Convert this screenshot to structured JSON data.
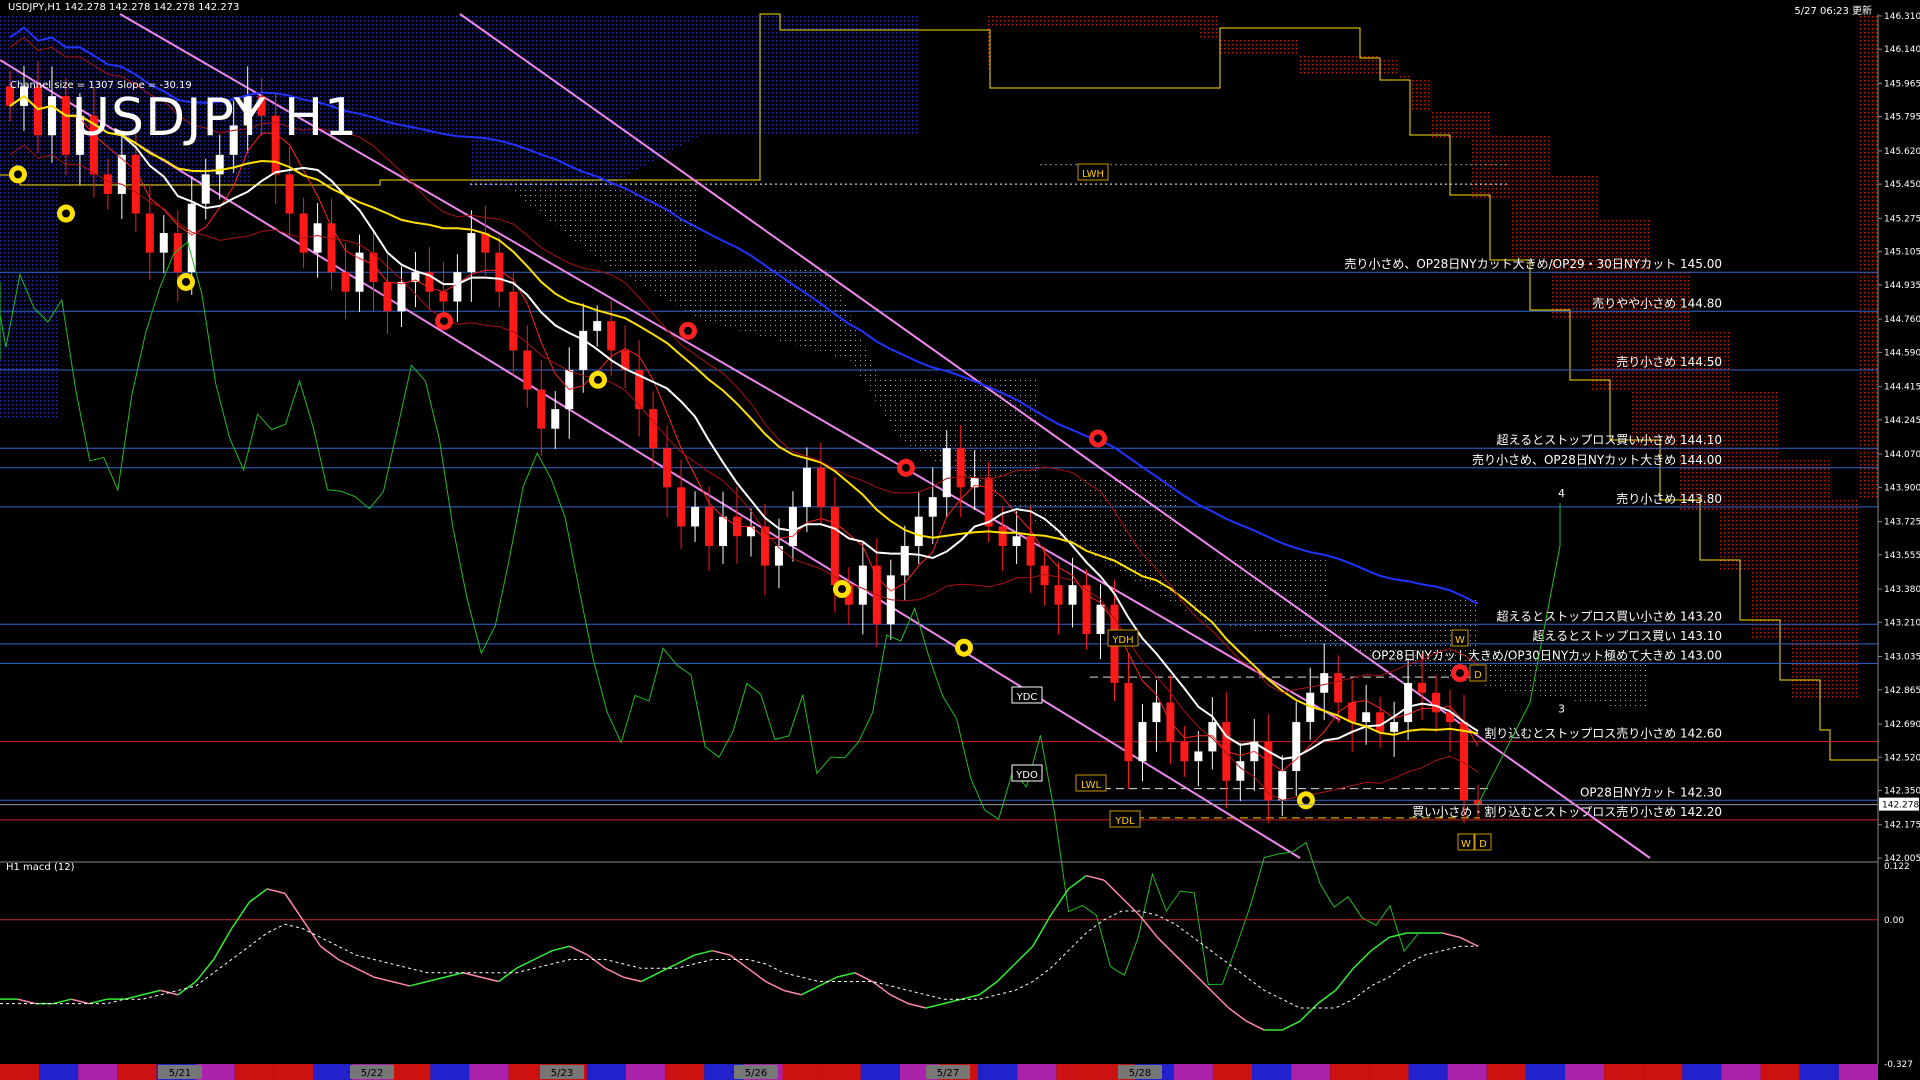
{
  "header": {
    "ohlc_text": "USDJPY,H1  142.278 142.278 142.278 142.273",
    "timestamp": "5/27 06:23 更新"
  },
  "symbol_label": "USDJPY H1",
  "channel_info": "Channel size = 1307 Slope = -30.19",
  "macd_label": "H1  macd (12)",
  "colors": {
    "background": "#000000",
    "bull_candle": "#ffffff",
    "bear_candle": "#ff1a1a",
    "ma_white": "#ffffff",
    "ma_yellow": "#ffe000",
    "ma_blue": "#2233ff",
    "channel_violet": "#ee88ee",
    "chikou_green": "#22bb22",
    "kumo_blue": "#2233cc",
    "kumo_red": "#cc2200",
    "level_line": "#3366cc",
    "macd_green": "#33ee33",
    "macd_pink": "#ff88aa"
  },
  "chart_data": [
    {
      "type": "line",
      "panel": "main",
      "y_axis_range": [
        142.005,
        146.32
      ],
      "y_ticks": [
        146.31,
        146.14,
        145.965,
        145.795,
        145.62,
        145.45,
        145.275,
        145.105,
        144.935,
        144.76,
        144.59,
        144.415,
        144.245,
        144.07,
        143.9,
        143.725,
        143.555,
        143.38,
        143.21,
        143.035,
        142.865,
        142.69,
        142.52,
        142.35,
        142.175,
        142.005
      ],
      "x_labels": [
        "5/21",
        "5/22",
        "5/23",
        "5/26",
        "5/27",
        "5/28"
      ],
      "current_price": 142.278,
      "levels": [
        {
          "price": 145.0,
          "label": "売り小さめ、OP28日NYカット大きめ/OP29・30日NYカット 145.00"
        },
        {
          "price": 144.8,
          "label": "売りやや小さめ 144.80"
        },
        {
          "price": 144.5,
          "label": "売り小さめ 144.50"
        },
        {
          "price": 144.1,
          "label": "超えるとストップロス買い小さめ 144.10"
        },
        {
          "price": 144.0,
          "label": "売り小さめ、OP28日NYカット大きめ 144.00"
        },
        {
          "price": 143.8,
          "label": "売り小さめ 143.80"
        },
        {
          "price": 143.2,
          "label": "超えるとストップロス買い小さめ 143.20"
        },
        {
          "price": 143.1,
          "label": "超えるとストップロス買い 143.10"
        },
        {
          "price": 143.0,
          "label": "OP28日NYカット大きめ/OP30日NYカット極めて大きめ 143.00"
        },
        {
          "price": 142.6,
          "label": "割り込むとストップロス売り小さめ 142.60"
        },
        {
          "price": 142.3,
          "label": "OP28日NYカット 142.30"
        },
        {
          "price": 142.2,
          "label": "買い小さめ・割り込むとストップロス売り小さめ 142.20"
        }
      ],
      "markers": [
        "LWH",
        "YDH",
        "YDC",
        "YDO",
        "LWL",
        "YDL",
        "W",
        "D"
      ],
      "wave_numbers": [
        "4",
        "3"
      ],
      "candles_close": [
        145.85,
        145.95,
        145.7,
        145.9,
        145.6,
        145.8,
        145.5,
        145.4,
        145.6,
        145.3,
        145.1,
        145.2,
        145.0,
        145.35,
        145.5,
        145.6,
        145.75,
        145.9,
        145.8,
        145.5,
        145.3,
        145.1,
        145.25,
        145.0,
        144.9,
        145.1,
        144.95,
        144.8,
        144.95,
        145.0,
        144.9,
        144.85,
        145.0,
        145.2,
        145.1,
        144.9,
        144.6,
        144.4,
        144.2,
        144.3,
        144.5,
        144.7,
        144.75,
        144.6,
        144.5,
        144.3,
        144.1,
        143.9,
        143.7,
        143.8,
        143.6,
        143.75,
        143.65,
        143.7,
        143.5,
        143.6,
        143.8,
        144.0,
        143.8,
        143.4,
        143.3,
        143.5,
        143.2,
        143.45,
        143.6,
        143.75,
        143.85,
        144.1,
        143.9,
        143.95,
        143.7,
        143.6,
        143.65,
        143.5,
        143.4,
        143.3,
        143.4,
        143.15,
        143.3,
        142.9,
        142.5,
        142.7,
        142.8,
        142.6,
        142.5,
        142.55,
        142.7,
        142.4,
        142.5,
        142.6,
        142.3,
        142.45,
        142.7,
        142.85,
        142.95,
        142.8,
        142.7,
        142.75,
        142.65,
        142.7,
        142.9,
        142.85,
        142.75,
        142.7,
        142.3,
        142.28
      ]
    },
    {
      "type": "line",
      "panel": "macd",
      "y_axis_range": [
        -0.327,
        0.122
      ],
      "y_ticks": [
        0.122,
        0.0,
        -0.327
      ],
      "series": [
        {
          "name": "macd",
          "values": [
            -0.18,
            -0.18,
            -0.19,
            -0.19,
            -0.18,
            -0.19,
            -0.18,
            -0.18,
            -0.17,
            -0.16,
            -0.17,
            -0.14,
            -0.09,
            -0.02,
            0.04,
            0.07,
            0.06,
            0.0,
            -0.06,
            -0.09,
            -0.11,
            -0.13,
            -0.14,
            -0.15,
            -0.14,
            -0.13,
            -0.12,
            -0.13,
            -0.14,
            -0.11,
            -0.09,
            -0.07,
            -0.06,
            -0.08,
            -0.11,
            -0.13,
            -0.14,
            -0.12,
            -0.1,
            -0.08,
            -0.07,
            -0.08,
            -0.11,
            -0.14,
            -0.16,
            -0.17,
            -0.15,
            -0.13,
            -0.12,
            -0.14,
            -0.17,
            -0.19,
            -0.2,
            -0.19,
            -0.18,
            -0.17,
            -0.14,
            -0.1,
            -0.06,
            0.01,
            0.07,
            0.1,
            0.09,
            0.05,
            0.01,
            -0.04,
            -0.08,
            -0.12,
            -0.16,
            -0.2,
            -0.23,
            -0.25,
            -0.25,
            -0.23,
            -0.19,
            -0.16,
            -0.11,
            -0.07,
            -0.04,
            -0.03,
            -0.03,
            -0.03,
            -0.04,
            -0.06
          ]
        },
        {
          "name": "signal",
          "values": [
            -0.19,
            -0.19,
            -0.19,
            -0.19,
            -0.19,
            -0.19,
            -0.19,
            -0.18,
            -0.18,
            -0.17,
            -0.16,
            -0.15,
            -0.12,
            -0.09,
            -0.06,
            -0.03,
            -0.01,
            -0.02,
            -0.04,
            -0.06,
            -0.08,
            -0.09,
            -0.1,
            -0.11,
            -0.12,
            -0.12,
            -0.12,
            -0.12,
            -0.12,
            -0.12,
            -0.11,
            -0.1,
            -0.09,
            -0.09,
            -0.09,
            -0.1,
            -0.11,
            -0.11,
            -0.11,
            -0.1,
            -0.09,
            -0.09,
            -0.09,
            -0.1,
            -0.12,
            -0.13,
            -0.14,
            -0.14,
            -0.14,
            -0.14,
            -0.15,
            -0.16,
            -0.17,
            -0.18,
            -0.18,
            -0.18,
            -0.17,
            -0.16,
            -0.14,
            -0.11,
            -0.07,
            -0.03,
            0.0,
            0.02,
            0.02,
            0.01,
            -0.01,
            -0.04,
            -0.07,
            -0.1,
            -0.13,
            -0.16,
            -0.18,
            -0.2,
            -0.2,
            -0.2,
            -0.18,
            -0.15,
            -0.13,
            -0.1,
            -0.08,
            -0.07,
            -0.06,
            -0.06
          ]
        }
      ]
    }
  ]
}
